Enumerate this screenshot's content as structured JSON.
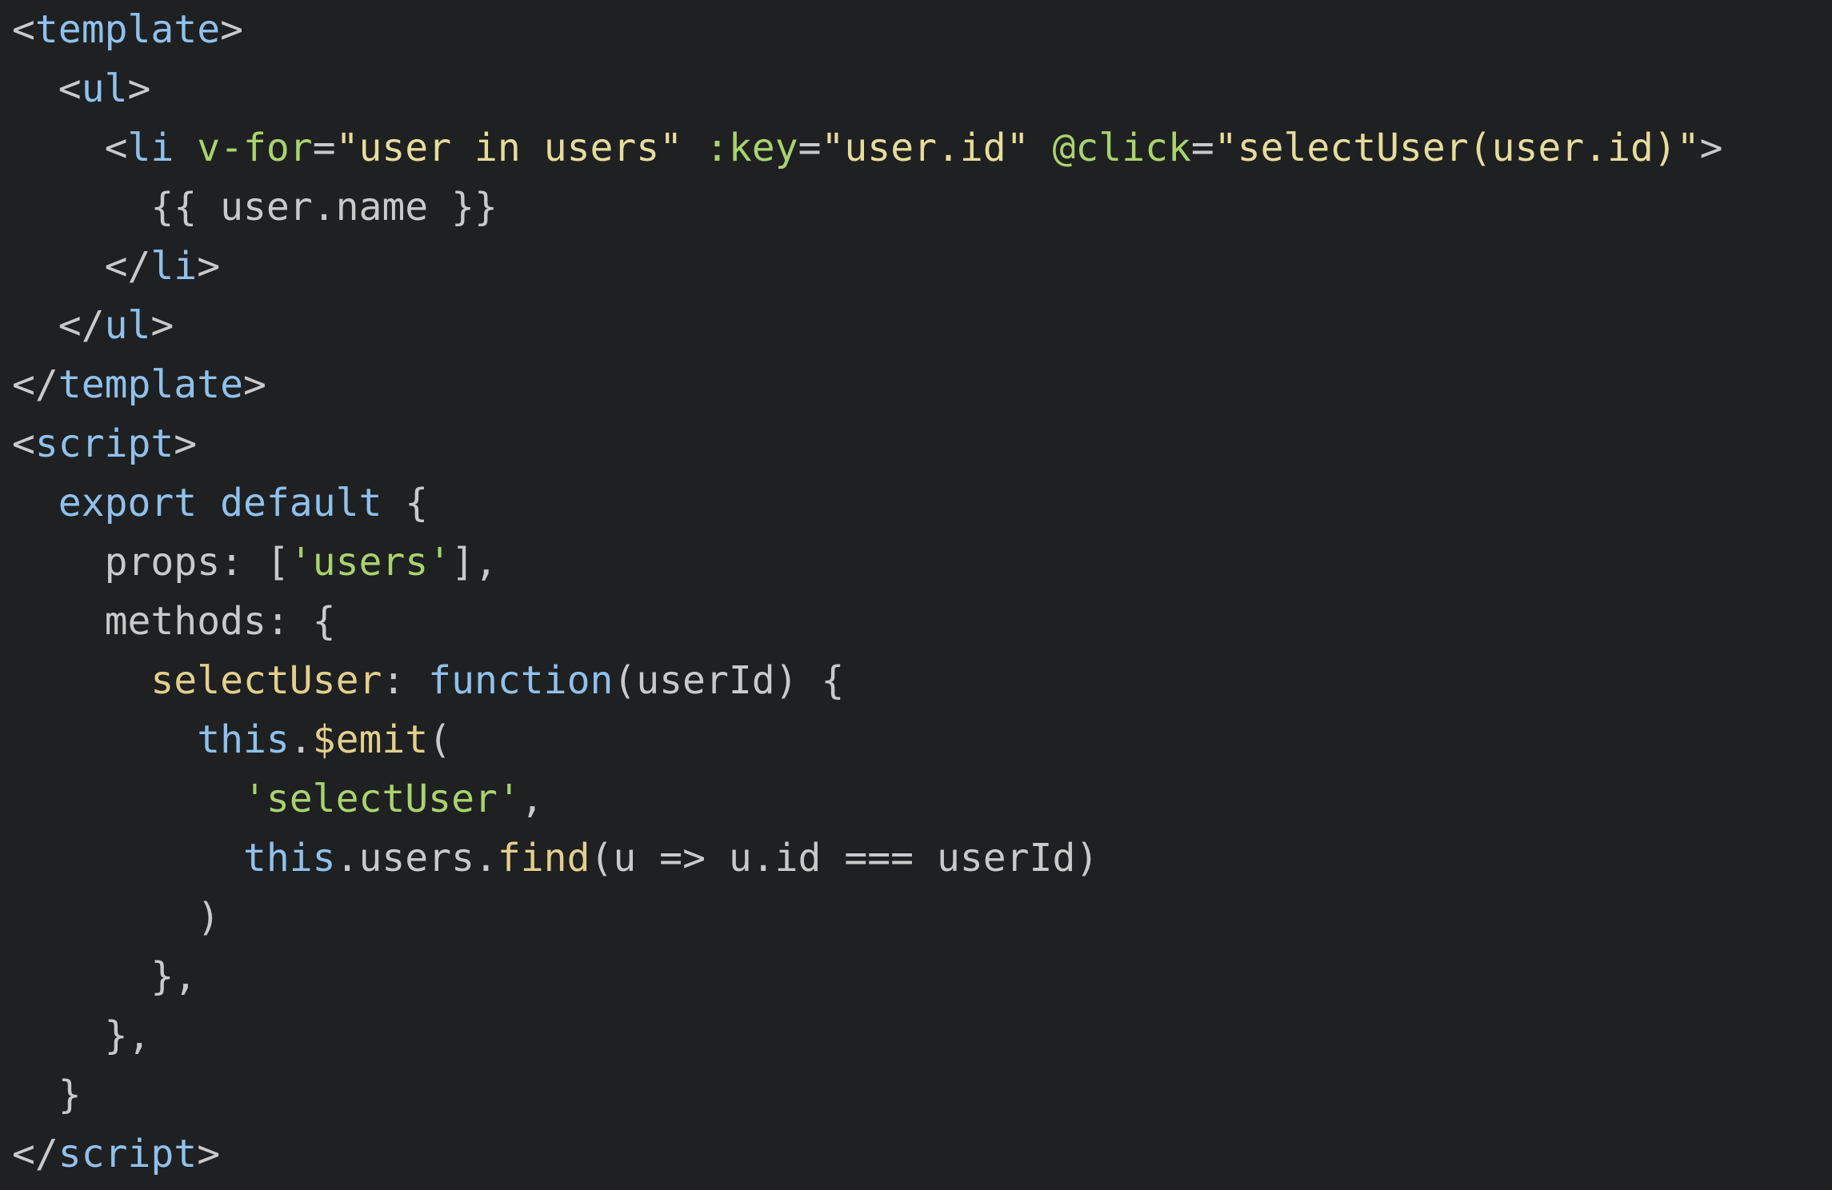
{
  "colors": {
    "background": "#1f2022",
    "plain": "#c9c9c9",
    "punct": "#c9c9c9",
    "tag": "#8fc1ec",
    "attr": "#a9d36e",
    "string": "#e6dc9c",
    "keyword": "#8fc1ec",
    "func": "#e3cf8c",
    "prop": "#c9c9c9",
    "js_string": "#a9d36e"
  },
  "editor": {
    "lines": [
      {
        "tokens": [
          {
            "t": "punct",
            "v": "<"
          },
          {
            "t": "tag",
            "v": "template"
          },
          {
            "t": "punct",
            "v": ">"
          }
        ]
      },
      {
        "tokens": [
          {
            "t": "plain",
            "v": "  "
          },
          {
            "t": "punct",
            "v": "<"
          },
          {
            "t": "tag",
            "v": "ul"
          },
          {
            "t": "punct",
            "v": ">"
          }
        ]
      },
      {
        "tokens": [
          {
            "t": "plain",
            "v": "    "
          },
          {
            "t": "punct",
            "v": "<"
          },
          {
            "t": "tag",
            "v": "li"
          },
          {
            "t": "plain",
            "v": " "
          },
          {
            "t": "attr",
            "v": "v-for"
          },
          {
            "t": "punct",
            "v": "="
          },
          {
            "t": "string",
            "v": "\"user in users\""
          },
          {
            "t": "plain",
            "v": " "
          },
          {
            "t": "attr",
            "v": ":key"
          },
          {
            "t": "punct",
            "v": "="
          },
          {
            "t": "string",
            "v": "\"user.id\""
          },
          {
            "t": "plain",
            "v": " "
          },
          {
            "t": "attr",
            "v": "@click"
          },
          {
            "t": "punct",
            "v": "="
          },
          {
            "t": "string",
            "v": "\"selectUser(user.id)\""
          },
          {
            "t": "punct",
            "v": ">"
          }
        ]
      },
      {
        "tokens": [
          {
            "t": "plain",
            "v": "      {{ user.name }}"
          }
        ]
      },
      {
        "tokens": [
          {
            "t": "plain",
            "v": "    "
          },
          {
            "t": "punct",
            "v": "</"
          },
          {
            "t": "tag",
            "v": "li"
          },
          {
            "t": "punct",
            "v": ">"
          }
        ]
      },
      {
        "tokens": [
          {
            "t": "plain",
            "v": "  "
          },
          {
            "t": "punct",
            "v": "</"
          },
          {
            "t": "tag",
            "v": "ul"
          },
          {
            "t": "punct",
            "v": ">"
          }
        ]
      },
      {
        "tokens": [
          {
            "t": "punct",
            "v": "</"
          },
          {
            "t": "tag",
            "v": "template"
          },
          {
            "t": "punct",
            "v": ">"
          }
        ]
      },
      {
        "tokens": [
          {
            "t": "punct",
            "v": "<"
          },
          {
            "t": "tag",
            "v": "script"
          },
          {
            "t": "punct",
            "v": ">"
          }
        ]
      },
      {
        "tokens": [
          {
            "t": "plain",
            "v": "  "
          },
          {
            "t": "keyword",
            "v": "export"
          },
          {
            "t": "plain",
            "v": " "
          },
          {
            "t": "keyword",
            "v": "default"
          },
          {
            "t": "plain",
            "v": " {"
          }
        ]
      },
      {
        "tokens": [
          {
            "t": "plain",
            "v": "    props: ["
          },
          {
            "t": "js_string",
            "v": "'users'"
          },
          {
            "t": "plain",
            "v": "],"
          }
        ]
      },
      {
        "tokens": [
          {
            "t": "plain",
            "v": "    methods: {"
          }
        ]
      },
      {
        "tokens": [
          {
            "t": "plain",
            "v": "      "
          },
          {
            "t": "func",
            "v": "selectUser"
          },
          {
            "t": "plain",
            "v": ": "
          },
          {
            "t": "keyword",
            "v": "function"
          },
          {
            "t": "plain",
            "v": "(userId) {"
          }
        ]
      },
      {
        "tokens": [
          {
            "t": "plain",
            "v": "        "
          },
          {
            "t": "keyword",
            "v": "this"
          },
          {
            "t": "plain",
            "v": "."
          },
          {
            "t": "func",
            "v": "$emit"
          },
          {
            "t": "plain",
            "v": "("
          }
        ]
      },
      {
        "tokens": [
          {
            "t": "plain",
            "v": "          "
          },
          {
            "t": "js_string",
            "v": "'selectUser'"
          },
          {
            "t": "plain",
            "v": ","
          }
        ]
      },
      {
        "tokens": [
          {
            "t": "plain",
            "v": "          "
          },
          {
            "t": "keyword",
            "v": "this"
          },
          {
            "t": "plain",
            "v": ".users."
          },
          {
            "t": "func",
            "v": "find"
          },
          {
            "t": "plain",
            "v": "(u => u.id === userId)"
          }
        ]
      },
      {
        "tokens": [
          {
            "t": "plain",
            "v": "        )"
          }
        ]
      },
      {
        "tokens": [
          {
            "t": "plain",
            "v": "      },"
          }
        ]
      },
      {
        "tokens": [
          {
            "t": "plain",
            "v": "    },"
          }
        ]
      },
      {
        "tokens": [
          {
            "t": "plain",
            "v": "  }"
          }
        ]
      },
      {
        "tokens": [
          {
            "t": "punct",
            "v": "</"
          },
          {
            "t": "tag",
            "v": "script"
          },
          {
            "t": "punct",
            "v": ">"
          }
        ]
      }
    ]
  }
}
